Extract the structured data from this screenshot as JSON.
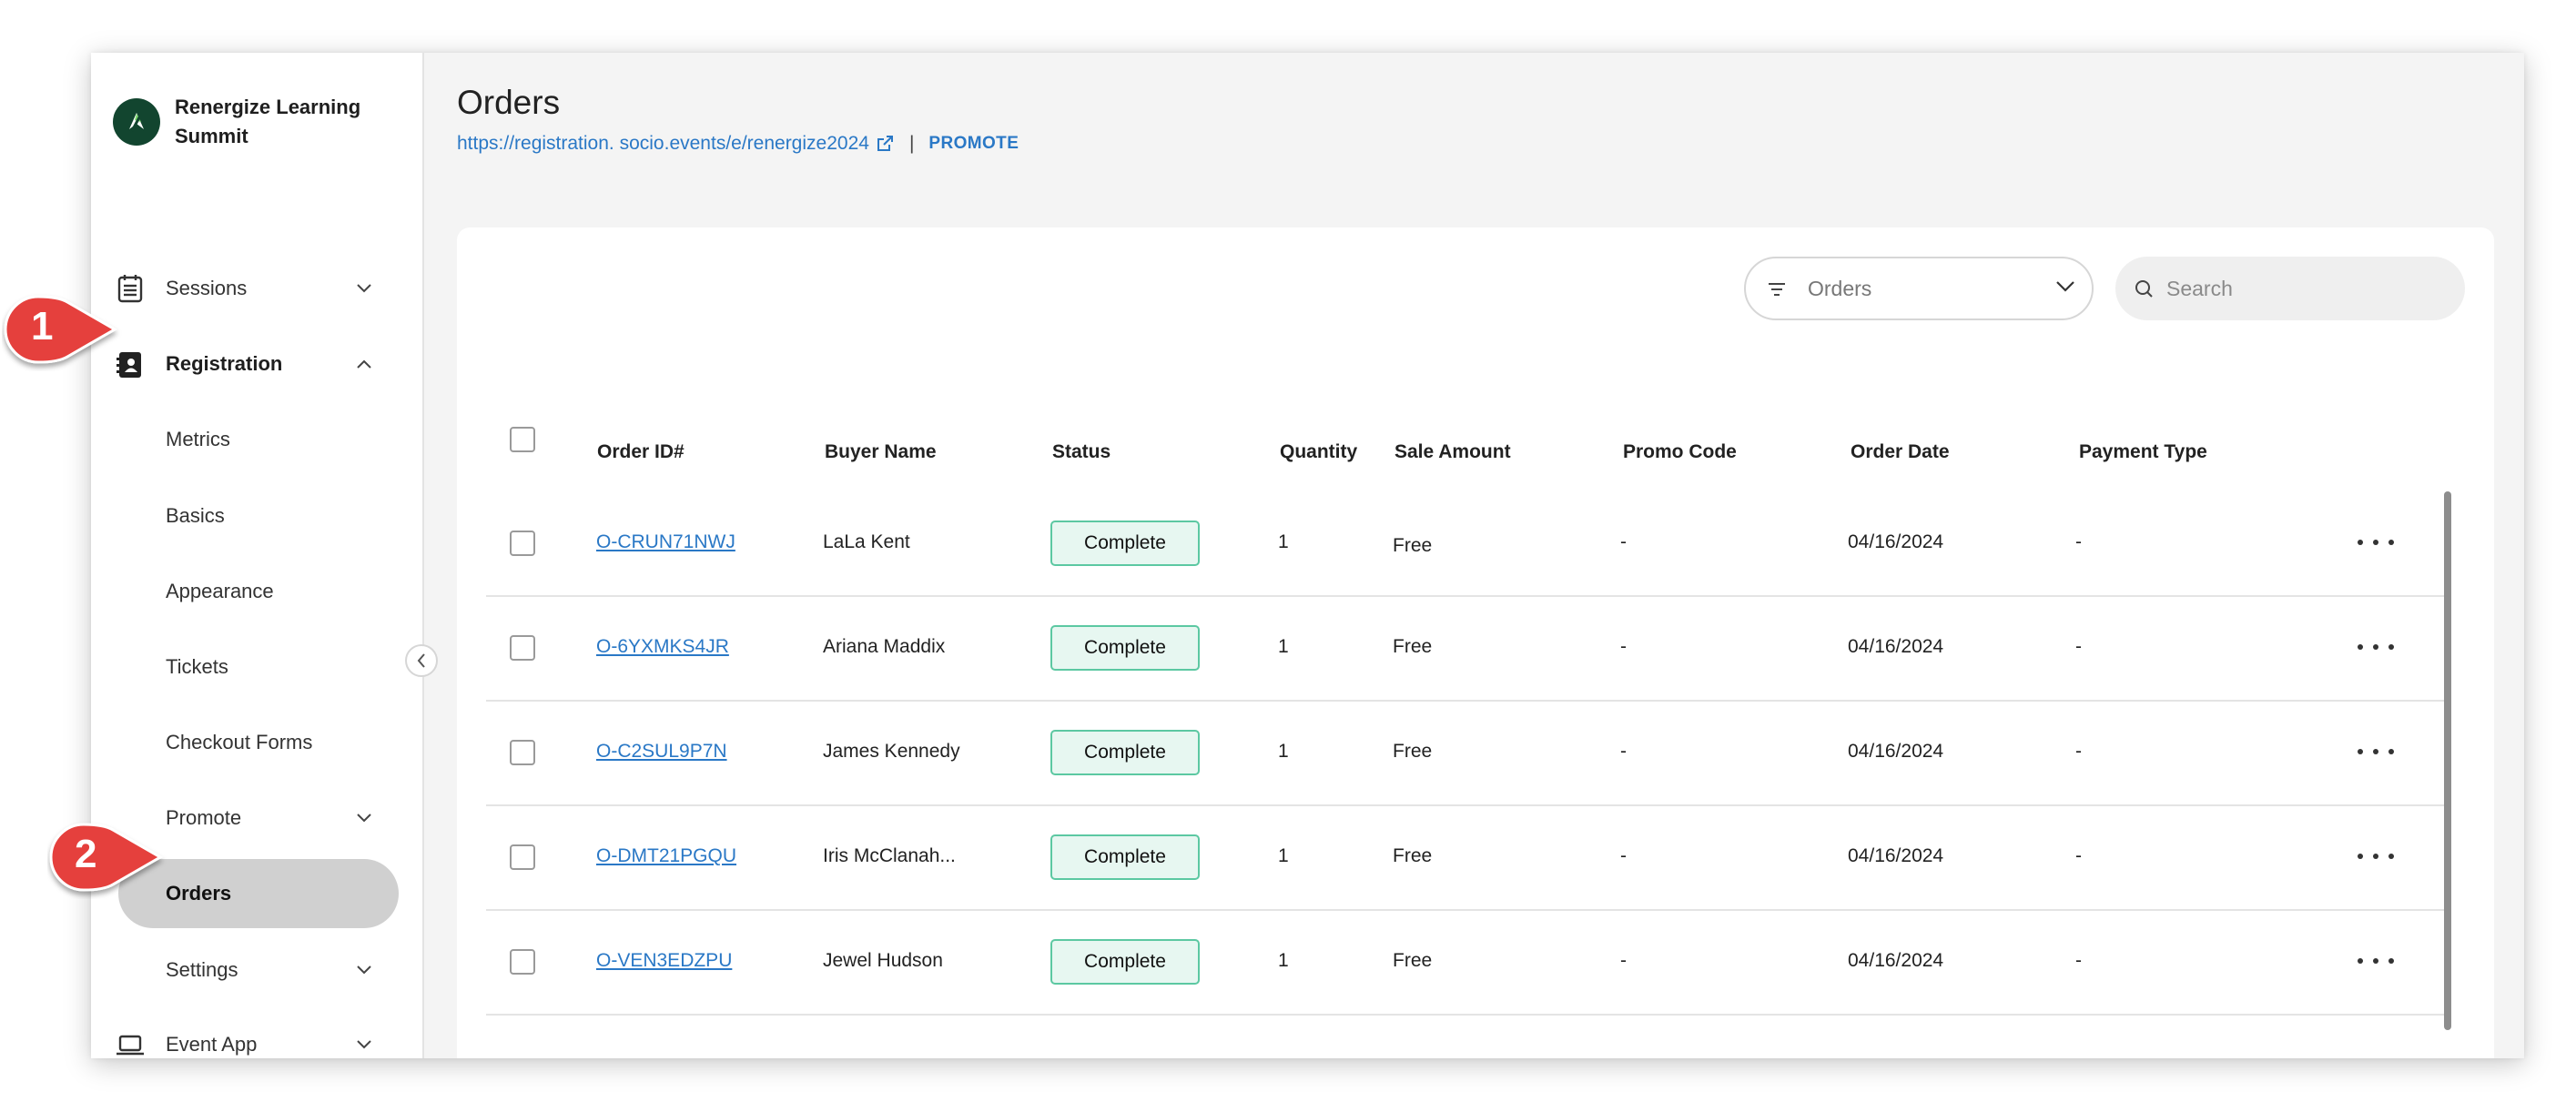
{
  "brand": {
    "name": "Renergize Learning Summit"
  },
  "sidebar": {
    "items": [
      {
        "label": "Sessions"
      },
      {
        "label": "Registration"
      },
      {
        "label": "Metrics"
      },
      {
        "label": "Basics"
      },
      {
        "label": "Appearance"
      },
      {
        "label": "Tickets"
      },
      {
        "label": "Checkout Forms"
      },
      {
        "label": "Promote"
      },
      {
        "label": "Orders"
      },
      {
        "label": "Settings"
      },
      {
        "label": "Event App"
      }
    ]
  },
  "header": {
    "title": "Orders",
    "url": "https://registration. socio.events/e/renergize2024",
    "separator": "|",
    "promote_label": "PROMOTE"
  },
  "toolbar": {
    "filter_label": "Orders",
    "search_placeholder": "Search"
  },
  "table": {
    "columns": [
      "Order ID#",
      "Buyer Name",
      "Status",
      "Quantity",
      "Sale Amount",
      "Promo Code",
      "Order Date",
      "Payment Type"
    ],
    "rows": [
      {
        "order_id": "O-CRUN71NWJ",
        "buyer": "LaLa Kent",
        "status": "Complete",
        "quantity": "1",
        "sale_amount": "Free",
        "promo": "-",
        "date": "04/16/2024",
        "payment": "-"
      },
      {
        "order_id": "O-6YXMKS4JR",
        "buyer": "Ariana Maddix",
        "status": "Complete",
        "quantity": "1",
        "sale_amount": "Free",
        "promo": "-",
        "date": "04/16/2024",
        "payment": "-"
      },
      {
        "order_id": "O-C2SUL9P7N",
        "buyer": "James Kennedy",
        "status": "Complete",
        "quantity": "1",
        "sale_amount": "Free",
        "promo": "-",
        "date": "04/16/2024",
        "payment": "-"
      },
      {
        "order_id": "O-DMT21PGQU",
        "buyer": "Iris McClanah...",
        "status": "Complete",
        "quantity": "1",
        "sale_amount": "Free",
        "promo": "-",
        "date": "04/16/2024",
        "payment": "-"
      },
      {
        "order_id": "O-VEN3EDZPU",
        "buyer": "Jewel Hudson",
        "status": "Complete",
        "quantity": "1",
        "sale_amount": "Free",
        "promo": "-",
        "date": "04/16/2024",
        "payment": "-"
      }
    ]
  },
  "callouts": {
    "step1": "1",
    "step2": "2"
  },
  "colors": {
    "accent": "#2a78c6",
    "callout": "#e5403d",
    "status_border": "#5cc8a2",
    "status_bg": "#e7f7f1",
    "brand_logo": "#12452f"
  }
}
